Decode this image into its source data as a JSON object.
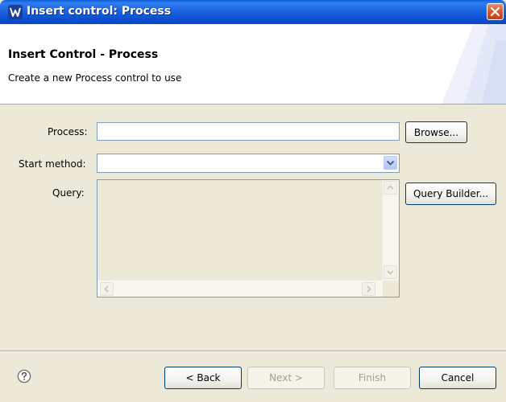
{
  "window": {
    "title": "Insert control: Process",
    "close_icon": "close-icon"
  },
  "banner": {
    "heading": "Insert Control - Process",
    "description": "Create a new Process control to use"
  },
  "form": {
    "process_label": "Process:",
    "process_value": "",
    "browse_label": "Browse...",
    "start_method_label": "Start method:",
    "start_method_value": "",
    "query_label": "Query:",
    "query_value": "",
    "query_builder_label": "Query Builder..."
  },
  "footer": {
    "help_icon": "help-icon",
    "back_label": "< Back",
    "next_label": "Next >",
    "finish_label": "Finish",
    "cancel_label": "Cancel"
  },
  "colors": {
    "titlebar": "#0b4fd0",
    "dialog_bg": "#ece9d8",
    "input_border": "#7f9db9",
    "button_border": "#003c74"
  }
}
